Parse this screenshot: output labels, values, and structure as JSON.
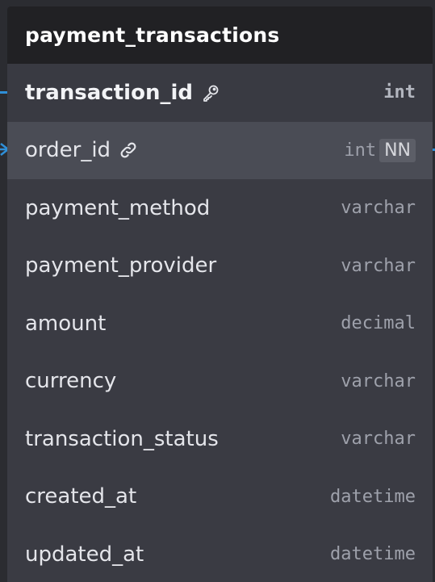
{
  "table": {
    "title": "payment_transactions",
    "columns": [
      {
        "name": "transaction_id",
        "type": "int",
        "key": "primary",
        "icon": "key-icon"
      },
      {
        "name": "order_id",
        "type": "int",
        "key": "foreign",
        "icon": "link-icon",
        "badge": "NN"
      },
      {
        "name": "payment_method",
        "type": "varchar"
      },
      {
        "name": "payment_provider",
        "type": "varchar"
      },
      {
        "name": "amount",
        "type": "decimal"
      },
      {
        "name": "currency",
        "type": "varchar"
      },
      {
        "name": "transaction_status",
        "type": "varchar"
      },
      {
        "name": "created_at",
        "type": "datetime"
      },
      {
        "name": "updated_at",
        "type": "datetime"
      }
    ]
  },
  "colors": {
    "background": "#2b2c31",
    "header": "#212124",
    "body": "#3a3b43",
    "selected_row": "#4a4c55",
    "connector": "#2f8fd8"
  }
}
